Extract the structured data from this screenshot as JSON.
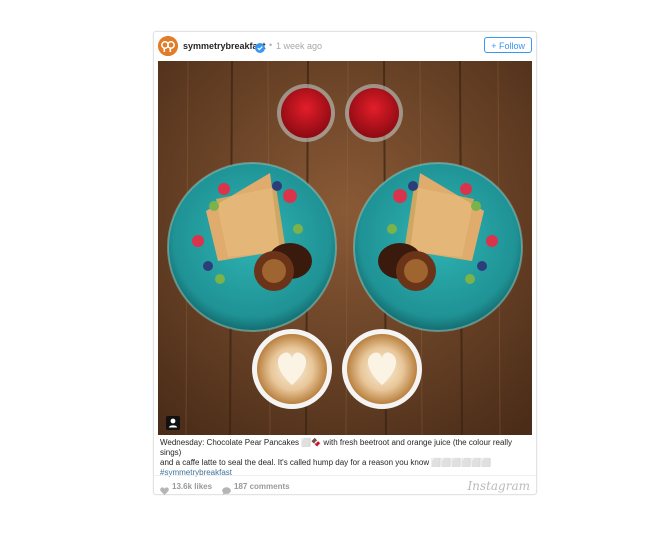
{
  "post": {
    "username": "symmetrybreakfast",
    "separator": "•",
    "time": "1 week ago",
    "follow_label": "+ Follow",
    "caption_line1": "Wednesday: Chocolate Pear Pancakes ⬜🍫 with fresh beetroot and orange juice (the colour really sings)",
    "caption_line2": "and a caffe latte to seal the deal. It's called hump day for a reason you know ⬜⬜⬜⬜⬜⬜",
    "hashtag": "#symmetrybreakfast",
    "likes": "13.6k likes",
    "comments": "187 comments",
    "brand": "Instagram"
  },
  "icons": {
    "verified": "verified-badge-icon",
    "heart": "heart-icon",
    "comment": "comment-icon",
    "user_tag": "user-tag-icon"
  },
  "colors": {
    "accent": "#3897f0",
    "hashtag": "#3f729b",
    "table_wood": "#6b4429",
    "plate": "#2aa6a8",
    "juice": "#c4141e"
  }
}
